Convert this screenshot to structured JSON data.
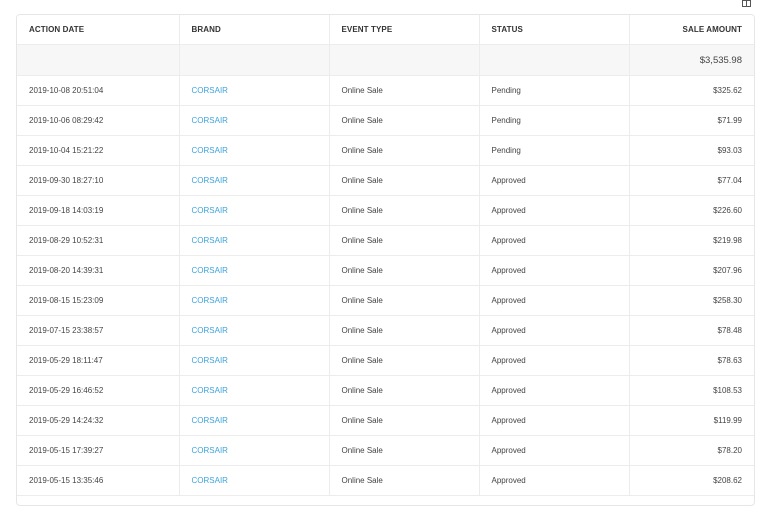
{
  "table": {
    "headers": {
      "action_date": "ACTION DATE",
      "brand": "BRAND",
      "event_type": "EVENT TYPE",
      "status": "STATUS",
      "sale_amount": "SALE AMOUNT"
    },
    "total": "$3,535.98",
    "rows": [
      {
        "date": "2019-10-08 20:51:04",
        "brand": "CORSAIR",
        "event": "Online Sale",
        "status": "Pending",
        "amount": "$325.62"
      },
      {
        "date": "2019-10-06 08:29:42",
        "brand": "CORSAIR",
        "event": "Online Sale",
        "status": "Pending",
        "amount": "$71.99"
      },
      {
        "date": "2019-10-04 15:21:22",
        "brand": "CORSAIR",
        "event": "Online Sale",
        "status": "Pending",
        "amount": "$93.03"
      },
      {
        "date": "2019-09-30 18:27:10",
        "brand": "CORSAIR",
        "event": "Online Sale",
        "status": "Approved",
        "amount": "$77.04"
      },
      {
        "date": "2019-09-18 14:03:19",
        "brand": "CORSAIR",
        "event": "Online Sale",
        "status": "Approved",
        "amount": "$226.60"
      },
      {
        "date": "2019-08-29 10:52:31",
        "brand": "CORSAIR",
        "event": "Online Sale",
        "status": "Approved",
        "amount": "$219.98"
      },
      {
        "date": "2019-08-20 14:39:31",
        "brand": "CORSAIR",
        "event": "Online Sale",
        "status": "Approved",
        "amount": "$207.96"
      },
      {
        "date": "2019-08-15 15:23:09",
        "brand": "CORSAIR",
        "event": "Online Sale",
        "status": "Approved",
        "amount": "$258.30"
      },
      {
        "date": "2019-07-15 23:38:57",
        "brand": "CORSAIR",
        "event": "Online Sale",
        "status": "Approved",
        "amount": "$78.48"
      },
      {
        "date": "2019-05-29 18:11:47",
        "brand": "CORSAIR",
        "event": "Online Sale",
        "status": "Approved",
        "amount": "$78.63"
      },
      {
        "date": "2019-05-29 16:46:52",
        "brand": "CORSAIR",
        "event": "Online Sale",
        "status": "Approved",
        "amount": "$108.53"
      },
      {
        "date": "2019-05-29 14:24:32",
        "brand": "CORSAIR",
        "event": "Online Sale",
        "status": "Approved",
        "amount": "$119.99"
      },
      {
        "date": "2019-05-15 17:39:27",
        "brand": "CORSAIR",
        "event": "Online Sale",
        "status": "Approved",
        "amount": "$78.20"
      },
      {
        "date": "2019-05-15 13:35:46",
        "brand": "CORSAIR",
        "event": "Online Sale",
        "status": "Approved",
        "amount": "$208.62"
      }
    ]
  },
  "colors": {
    "link": "#3da3dd",
    "total_row_bg": "#f7f7f8",
    "border": "#ececec"
  },
  "icons": {
    "top_right": "columns-icon"
  }
}
